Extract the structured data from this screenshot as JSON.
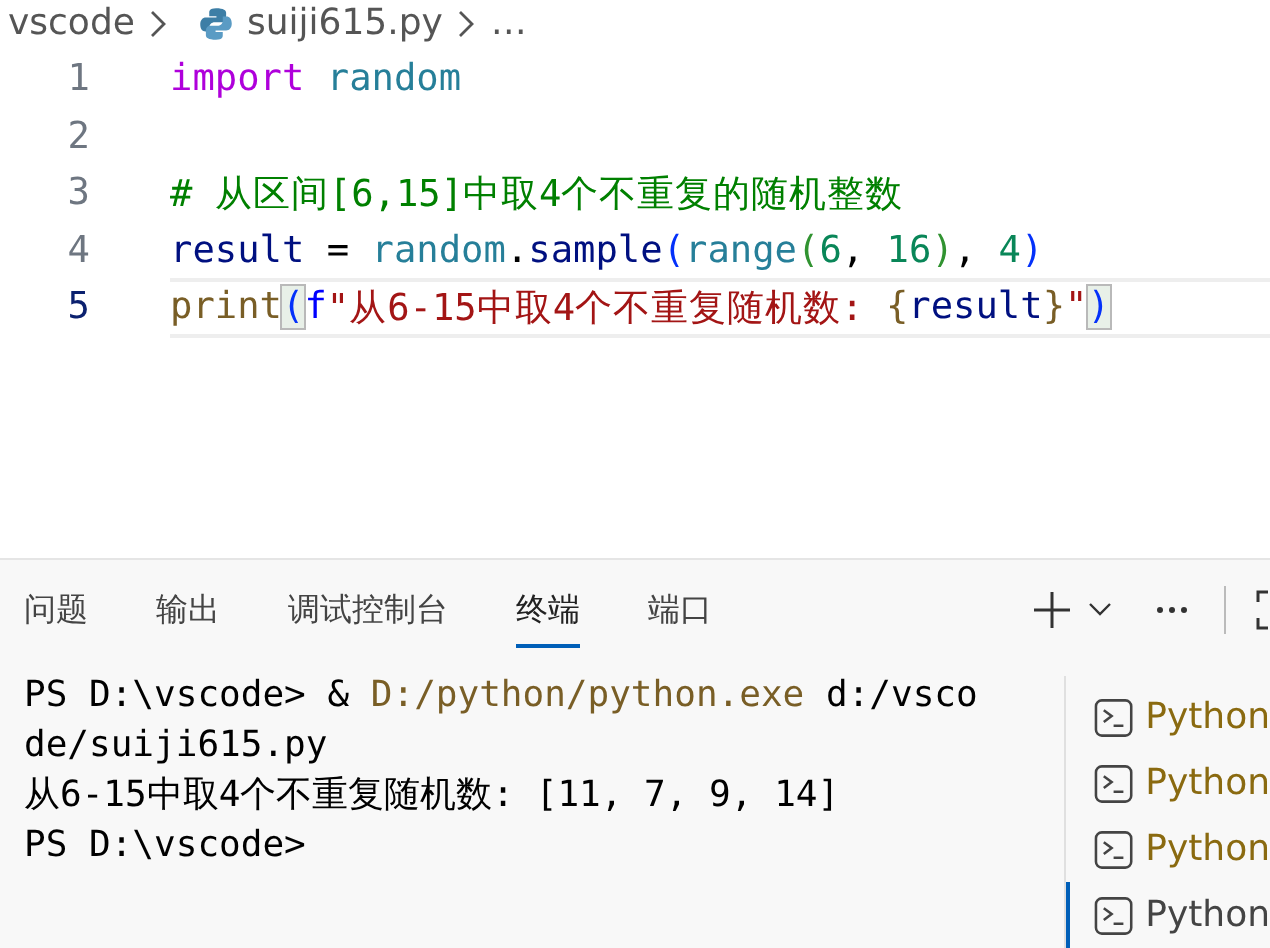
{
  "breadcrumb": [
    {
      "label": "vscode",
      "kind": "folder"
    },
    {
      "label": "suiji615.py",
      "kind": "python-file"
    },
    {
      "label": "…",
      "kind": "more"
    }
  ],
  "editor": {
    "lines": [
      {
        "number": "1",
        "current": false,
        "tokens": [
          {
            "text": "import ",
            "kind": "keyword"
          },
          {
            "text": "random",
            "kind": "module"
          }
        ]
      },
      {
        "number": "2",
        "current": false
      },
      {
        "number": "3",
        "current": false,
        "tokens": [
          {
            "text": "# 从区间[6,15]中取4个不重复的随机整数",
            "kind": "comment"
          }
        ]
      },
      {
        "number": "4",
        "current": false,
        "tokens": [
          {
            "text": "result",
            "kind": "variable"
          },
          {
            "text": " = ",
            "kind": "plain"
          },
          {
            "text": "random",
            "kind": "module"
          },
          {
            "text": ".",
            "kind": "plain"
          },
          {
            "text": "sample",
            "kind": "variable"
          },
          {
            "text": "(",
            "kind": "bracket2"
          },
          {
            "text": "range",
            "kind": "module"
          },
          {
            "text": "(",
            "kind": "bracket3"
          },
          {
            "text": "6",
            "kind": "number"
          },
          {
            "text": ", ",
            "kind": "plain"
          },
          {
            "text": "16",
            "kind": "number"
          },
          {
            "text": ")",
            "kind": "bracket3"
          },
          {
            "text": ", ",
            "kind": "plain"
          },
          {
            "text": "4",
            "kind": "number"
          },
          {
            "text": ")",
            "kind": "bracket2"
          }
        ]
      },
      {
        "number": "5",
        "current": true,
        "tokens": [
          {
            "text": "print",
            "kind": "function"
          },
          {
            "text": "(",
            "kind": "bracket-match"
          },
          {
            "text": "f",
            "kind": "fprefix"
          },
          {
            "text": "\"从6-15中取4个不重复随机数: ",
            "kind": "string"
          },
          {
            "text": "{",
            "kind": "bracket1"
          },
          {
            "text": "result",
            "kind": "variable"
          },
          {
            "text": "}",
            "kind": "bracket1"
          },
          {
            "text": "\"",
            "kind": "string"
          },
          {
            "text": ")",
            "kind": "bracket-match"
          }
        ]
      }
    ]
  },
  "panel": {
    "tabs": [
      {
        "label": "问题",
        "selected": false
      },
      {
        "label": "输出",
        "selected": false
      },
      {
        "label": "调试控制台",
        "selected": false
      },
      {
        "label": "终端",
        "selected": true
      },
      {
        "label": "端口",
        "selected": false
      }
    ],
    "terminal_lines": [
      [
        {
          "text": "PS D:\\vscode> & ",
          "kind": "plain"
        },
        {
          "text": "D:/python/python.exe",
          "kind": "command"
        },
        {
          "text": " d:/vsco",
          "kind": "plain"
        }
      ],
      [
        {
          "text": "de/suiji615.py",
          "kind": "plain"
        }
      ],
      [
        {
          "text": "从6-15中取4个不重复随机数: [11, 7, 9, 14]",
          "kind": "plain"
        }
      ],
      [
        {
          "text": "PS D:\\vscode>",
          "kind": "plain"
        }
      ]
    ],
    "terminals": [
      {
        "label": "Python",
        "selected": false
      },
      {
        "label": "Python",
        "selected": false
      },
      {
        "label": "Python",
        "selected": false
      },
      {
        "label": "Python",
        "selected": true
      }
    ]
  }
}
